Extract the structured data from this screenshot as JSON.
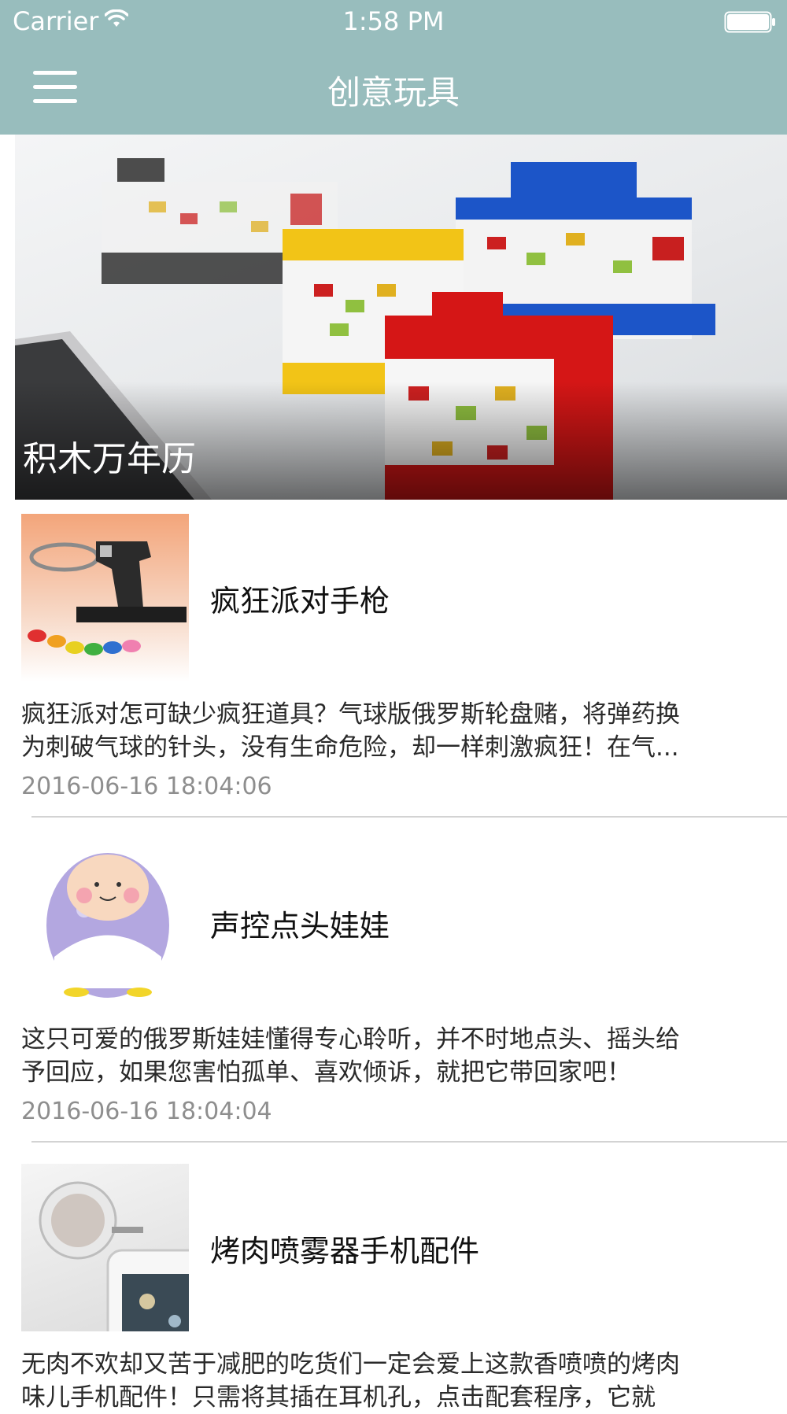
{
  "status_bar": {
    "carrier": "Carrier",
    "time": "1:58 PM",
    "wifi_icon": "wifi-icon",
    "battery_icon": "battery-icon"
  },
  "nav": {
    "title": "创意玩具",
    "menu_icon": "hamburger-menu-icon"
  },
  "banner": {
    "caption": "积木万年历"
  },
  "items": [
    {
      "title": "疯狂派对手枪",
      "description_line1": "疯狂派对怎可缺少疯狂道具？气球版俄罗斯轮盘赌，将弹药换",
      "description_line2": "为刺破气球的针头，没有生命危险，却一样刺激疯狂！在气...",
      "date": "2016-06-16 18:04:06"
    },
    {
      "title": "声控点头娃娃",
      "description_line1": "这只可爱的俄罗斯娃娃懂得专心聆听，并不时地点头、摇头给",
      "description_line2": "予回应，如果您害怕孤单、喜欢倾诉，就把它带回家吧！",
      "date": "2016-06-16 18:04:04"
    },
    {
      "title": "烤肉喷雾器手机配件",
      "description_line1": "无肉不欢却又苦于减肥的吃货们一定会爱上这款香喷喷的烤肉",
      "description_line2": "味儿手机配件！只需将其插在耳机孔，点击配套程序，它就"
    }
  ],
  "colors": {
    "nav_background": "#98bdbd",
    "date_text": "#8e8e8e",
    "divider": "#d3d3d3"
  }
}
